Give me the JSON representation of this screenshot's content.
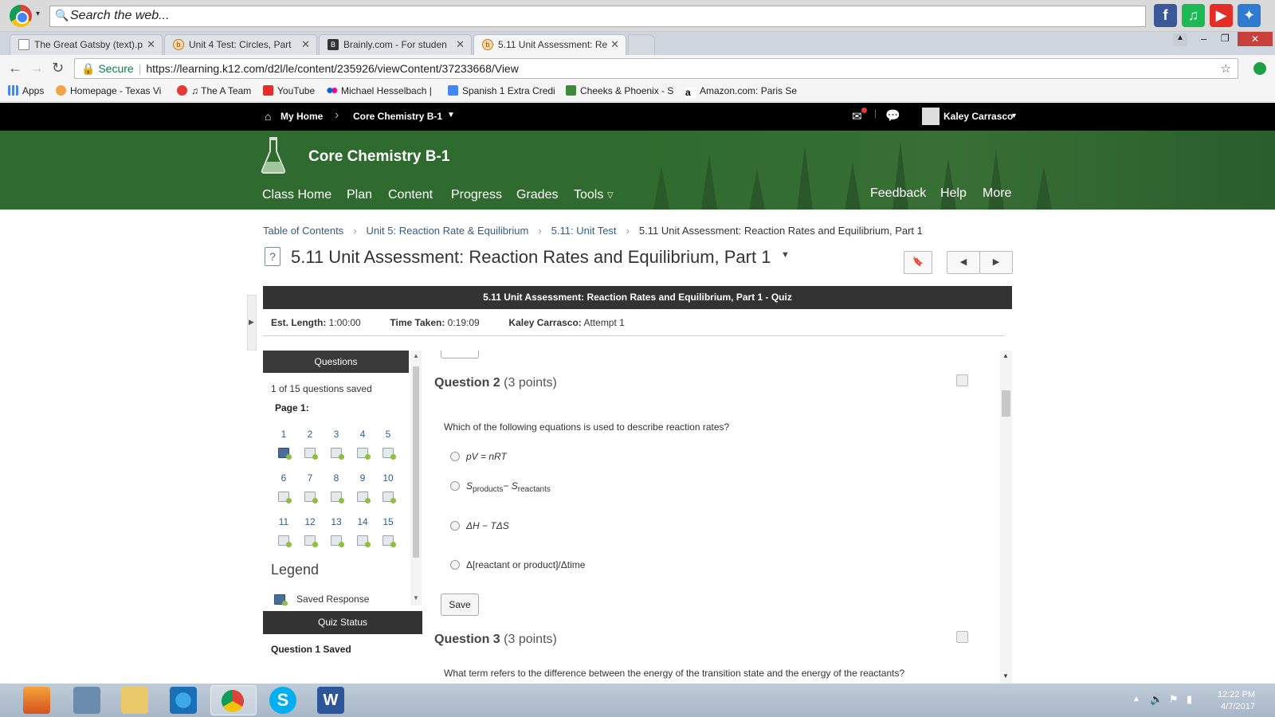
{
  "browser": {
    "search_placeholder": "Search the web...",
    "tabs": [
      {
        "title": "The Great Gatsby (text).p"
      },
      {
        "title": "Unit 4 Test: Circles, Part"
      },
      {
        "title": "Brainly.com - For studen"
      },
      {
        "title": "5.11 Unit Assessment: Re"
      }
    ],
    "secure_label": "Secure",
    "url": "https://learning.k12.com/d2l/le/content/235926/viewContent/37233668/View",
    "bookmarks": [
      {
        "label": "Apps"
      },
      {
        "label": "Homepage - Texas Vi"
      },
      {
        "label": "♫ The A Team"
      },
      {
        "label": "YouTube"
      },
      {
        "label": "Michael Hesselbach |"
      },
      {
        "label": "Spanish 1 Extra Credi"
      },
      {
        "label": "Cheeks & Phoenix - S"
      },
      {
        "label": "Amazon.com: Paris Se"
      }
    ]
  },
  "minibar": {
    "home": "My Home",
    "course": "Core Chemistry B-1",
    "user": "Kaley Carrasco"
  },
  "course": {
    "title": "Core Chemistry B-1",
    "nav": [
      "Class Home",
      "Plan",
      "Content",
      "Progress",
      "Grades",
      "Tools"
    ],
    "nav_right": [
      "Feedback",
      "Help",
      "More"
    ]
  },
  "breadcrumb": [
    "Table of Contents",
    "Unit 5: Reaction Rate & Equilibrium",
    "5.11: Unit Test",
    "5.11 Unit Assessment: Reaction Rates and Equilibrium, Part 1"
  ],
  "page_title": "5.11 Unit Assessment: Reaction Rates and Equilibrium, Part 1",
  "quiz_bar": "5.11 Unit Assessment: Reaction Rates and Equilibrium, Part 1 - Quiz",
  "info": {
    "est_label": "Est. Length:",
    "est_value": "1:00:00",
    "time_label": "Time Taken:",
    "time_value": "0:19:09",
    "user_label": "Kaley Carrasco:",
    "attempt": "Attempt 1"
  },
  "questions_panel": {
    "header": "Questions",
    "saved_count": "1 of 15 questions saved",
    "page_label": "Page 1:",
    "numbers": [
      "1",
      "2",
      "3",
      "4",
      "5",
      "6",
      "7",
      "8",
      "9",
      "10",
      "11",
      "12",
      "13",
      "14",
      "15"
    ],
    "legend_title": "Legend",
    "legend_saved": "Saved Response",
    "status_header": "Quiz Status",
    "status_text": "Question 1 Saved"
  },
  "question2": {
    "title": "Question 2",
    "points": "(3 points)",
    "text": "Which of the following equations is used to describe reaction rates?",
    "options": [
      {
        "text": "pV = nRT"
      },
      {
        "pre": "S",
        "sub1": "products",
        "mid": "− S",
        "sub2": "reactants"
      },
      {
        "text": "ΔH − TΔS"
      },
      {
        "text": "Δ[reactant or product]/Δtime"
      }
    ],
    "save_label": "Save"
  },
  "question3": {
    "title": "Question 3",
    "points": "(3 points)",
    "text": "What term refers to the difference between the energy of the transition state and the energy of the reactants?"
  },
  "taskbar": {
    "time": "12:22 PM",
    "date": "4/7/2017"
  }
}
